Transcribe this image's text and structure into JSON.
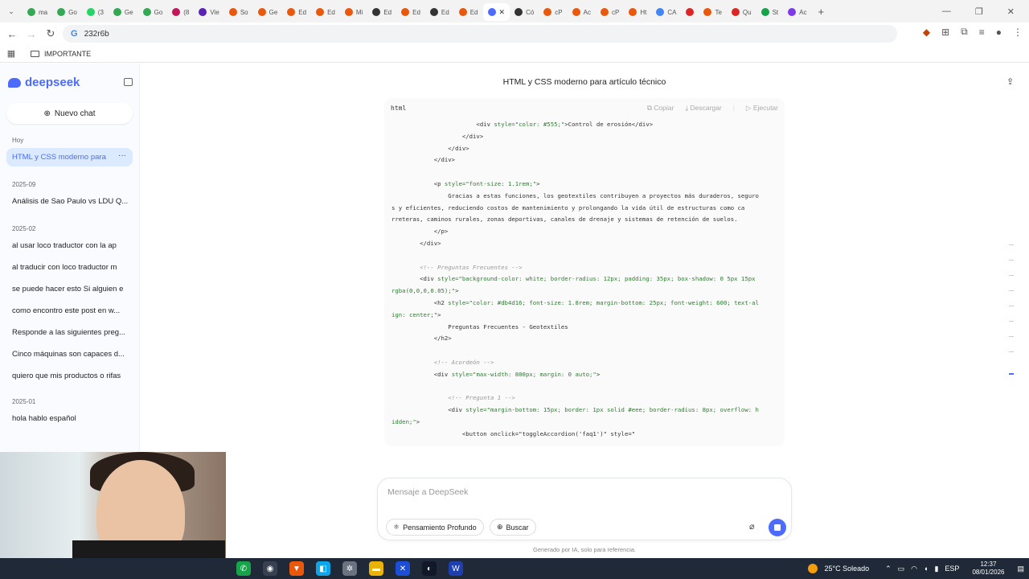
{
  "browser": {
    "tabs": [
      {
        "label": "ma",
        "color": "#34a853"
      },
      {
        "label": "Go",
        "color": "#34a853"
      },
      {
        "label": "(3",
        "color": "#25d366"
      },
      {
        "label": "Ge",
        "color": "#34a853"
      },
      {
        "label": "Go",
        "color": "#34a853"
      },
      {
        "label": "(8",
        "color": "#c2185b"
      },
      {
        "label": "Vie",
        "color": "#5b21b6"
      },
      {
        "label": "So",
        "color": "#ea580c"
      },
      {
        "label": "Ge",
        "color": "#ea580c"
      },
      {
        "label": "Ed",
        "color": "#ea580c"
      },
      {
        "label": "Ed",
        "color": "#ea580c"
      },
      {
        "label": "Mi",
        "color": "#ea580c"
      },
      {
        "label": "Ed",
        "color": "#333333"
      },
      {
        "label": "Ed",
        "color": "#ea580c"
      },
      {
        "label": "Ed",
        "color": "#333333"
      },
      {
        "label": "Ed",
        "color": "#ea580c"
      },
      {
        "label": "",
        "color": "#4d6bfe"
      },
      {
        "label": "Có",
        "color": "#333333"
      },
      {
        "label": "cP",
        "color": "#ea580c"
      },
      {
        "label": "Ac",
        "color": "#ea580c"
      },
      {
        "label": "cP",
        "color": "#ea580c"
      },
      {
        "label": "Ht",
        "color": "#ea580c"
      },
      {
        "label": "CA",
        "color": "#4285f4"
      },
      {
        "label": "",
        "color": "#dc2626"
      },
      {
        "label": "Te",
        "color": "#ea580c"
      },
      {
        "label": "Qu",
        "color": "#dc2626"
      },
      {
        "label": "St",
        "color": "#16a34a"
      },
      {
        "label": "Ac",
        "color": "#7c3aed"
      }
    ],
    "address": "232r6b",
    "bookmark_folder": "IMPORTANTE"
  },
  "sidebar": {
    "brand": "deepseek",
    "new_chat": "Nuevo chat",
    "sections": [
      {
        "title": "Hoy",
        "items": [
          "HTML y CSS moderno para"
        ]
      },
      {
        "title": "2025-09",
        "items": [
          "Análisis de Sao Paulo vs LDU Q..."
        ]
      },
      {
        "title": "2025-02",
        "items": [
          "al usar loco traductor con la ap",
          "al traducir con loco traductor m",
          "se puede hacer esto Si alguien e",
          "como encontro este post en w...",
          "Responde a las siguientes preg...",
          "Cinco máquinas son capaces d...",
          "quiero que mis productos o rifas"
        ]
      },
      {
        "title": "2025-01",
        "items": [
          "hola hablo español"
        ]
      }
    ]
  },
  "main": {
    "title": "HTML y CSS moderno para artículo técnico",
    "code_lang": "html",
    "actions": {
      "copy": "Copiar",
      "download": "Descargar",
      "run": "Ejecutar"
    }
  },
  "composer": {
    "placeholder": "Mensaje a DeepSeek",
    "deep_think": "Pensamiento Profundo",
    "search": "Buscar",
    "footnote": "Generado por IA, solo para referencia."
  },
  "taskbar": {
    "weather": "25°C Soleado",
    "lang": "ESP",
    "time": "12:37",
    "date": "08/01/2026"
  }
}
